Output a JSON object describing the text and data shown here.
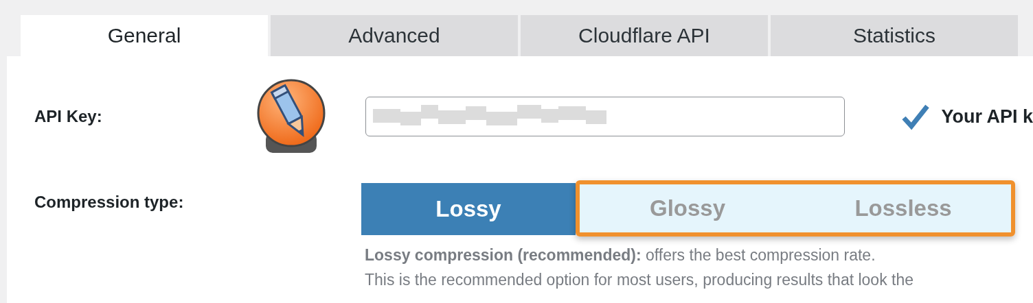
{
  "tabs": [
    {
      "label": "General",
      "selected": true
    },
    {
      "label": "Advanced",
      "selected": false
    },
    {
      "label": "Cloudflare API",
      "selected": false
    },
    {
      "label": "Statistics",
      "selected": false
    }
  ],
  "api_key": {
    "label": "API Key:",
    "status": "Your API k",
    "valid": true
  },
  "compression": {
    "label": "Compression type:",
    "options": [
      {
        "label": "Lossy",
        "selected": true,
        "highlighted": false
      },
      {
        "label": "Glossy",
        "selected": false,
        "highlighted": true
      },
      {
        "label": "Lossless",
        "selected": false,
        "highlighted": true
      }
    ],
    "description": {
      "title": "Lossy compression (recommended):",
      "text": " offers the best compression rate.",
      "detail": "This is the recommended option for most users, producing results that look the"
    }
  }
}
